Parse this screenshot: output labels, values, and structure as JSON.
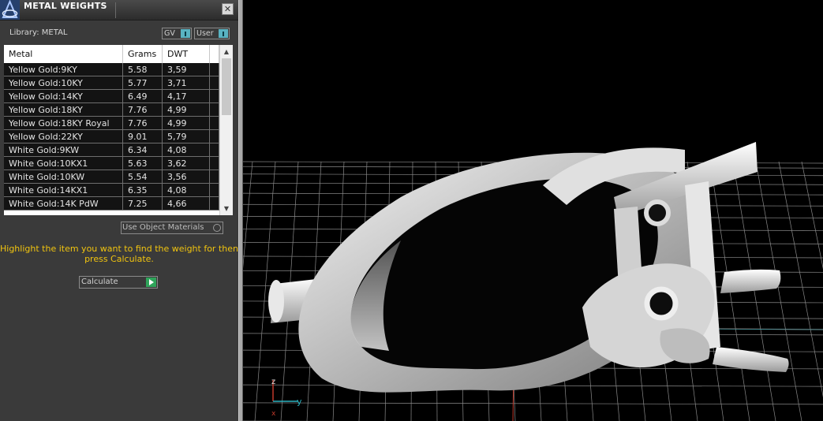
{
  "panel": {
    "title": "METAL WEIGHTS",
    "close_glyph": "✕",
    "library_label": "Library: METAL",
    "toggles": [
      {
        "label": "GV"
      },
      {
        "label": "User"
      }
    ],
    "table": {
      "columns": [
        "Metal",
        "Grams",
        "DWT"
      ],
      "rows": [
        [
          "Yellow Gold:9KY",
          "5.58",
          "3,59"
        ],
        [
          "Yellow Gold:10KY",
          "5.77",
          "3,71"
        ],
        [
          "Yellow Gold:14KY",
          "6.49",
          "4,17"
        ],
        [
          "Yellow Gold:18KY",
          "7.76",
          "4,99"
        ],
        [
          "Yellow Gold:18KY Royal",
          "7.76",
          "4,99"
        ],
        [
          "Yellow Gold:22KY",
          "9.01",
          "5,79"
        ],
        [
          "White Gold:9KW",
          "6.34",
          "4,08"
        ],
        [
          "White Gold:10KX1",
          "5.63",
          "3,62"
        ],
        [
          "White Gold:10KW",
          "5.54",
          "3,56"
        ],
        [
          "White Gold:14KX1",
          "6.35",
          "4,08"
        ],
        [
          "White Gold:14K PdW",
          "7.25",
          "4,66"
        ]
      ]
    },
    "use_object_materials": "Use Object Materials",
    "hint": "Highlight the item you want to find the weight for then press Calculate.",
    "calculate_label": "Calculate"
  },
  "viewport": {
    "axis_labels": {
      "z": "z",
      "y": "y",
      "x": "x"
    },
    "colors": {
      "grid": "#8a8a8a",
      "x_axis": "#c0392b",
      "y_axis": "#2ab3c0",
      "ring": "#d9d9d9"
    }
  },
  "icons": {
    "app_logo": "app-logo-icon",
    "close": "close-icon",
    "toggle": "toggle-switch-icon",
    "scroll_up": "scroll-up-arrow-icon",
    "scroll_down": "scroll-down-arrow-icon",
    "radio": "radio-icon",
    "go": "play-arrow-icon"
  }
}
